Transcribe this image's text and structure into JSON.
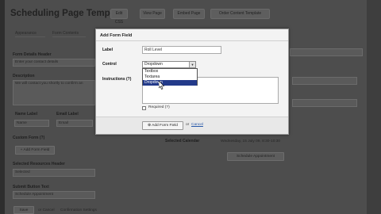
{
  "header": {
    "title": "Scheduling Page Template",
    "buttons": [
      "Edit CSS",
      "View Page",
      "Embed Page",
      "Order Content Template"
    ]
  },
  "tabs": [
    "Appearance",
    "Form Contents"
  ],
  "form": {
    "form_details_header": "Form Details Header",
    "form_details_value": "Enter your contact details",
    "description_label": "Description",
    "description_value": "We will contact you shortly to confirm an",
    "name_label": "Name Label",
    "name_value": "Name",
    "email_label": "Email Label",
    "email_value": "Email",
    "custom_form_label": "Custom Form (?)",
    "add_form_field_label": "+ Add Form Field",
    "selected_resources_header": "Selected Resources Header",
    "selected_resources_value": "Selected",
    "submit_button_text_label": "Submit Button Text",
    "submit_button_text_value": "Schedule Appointment",
    "save_label": "Save",
    "cancel_link": "or Cancel",
    "confirmation_link": "Confirmation Settings"
  },
  "right_panel": {
    "selected_calendar_label": "Selected Calendar",
    "selected_calendar_value": "Wednesday, 15 July 09, 8:30-10:30",
    "schedule_button": "Schedule Appointment"
  },
  "dialog": {
    "title": "Add Form Field",
    "label_label": "Label",
    "label_value": "Roll Level",
    "control_label": "Control",
    "control_value": "Dropdown",
    "control_options": [
      "Textbox",
      "Textarea",
      "Dropdown"
    ],
    "control_selected": "Dropdown",
    "instructions_label": "Instructions (?)",
    "required_label": "Required (?)",
    "add_button": "Add Form Field",
    "or_text": "or",
    "cancel_link": "Cancel"
  }
}
